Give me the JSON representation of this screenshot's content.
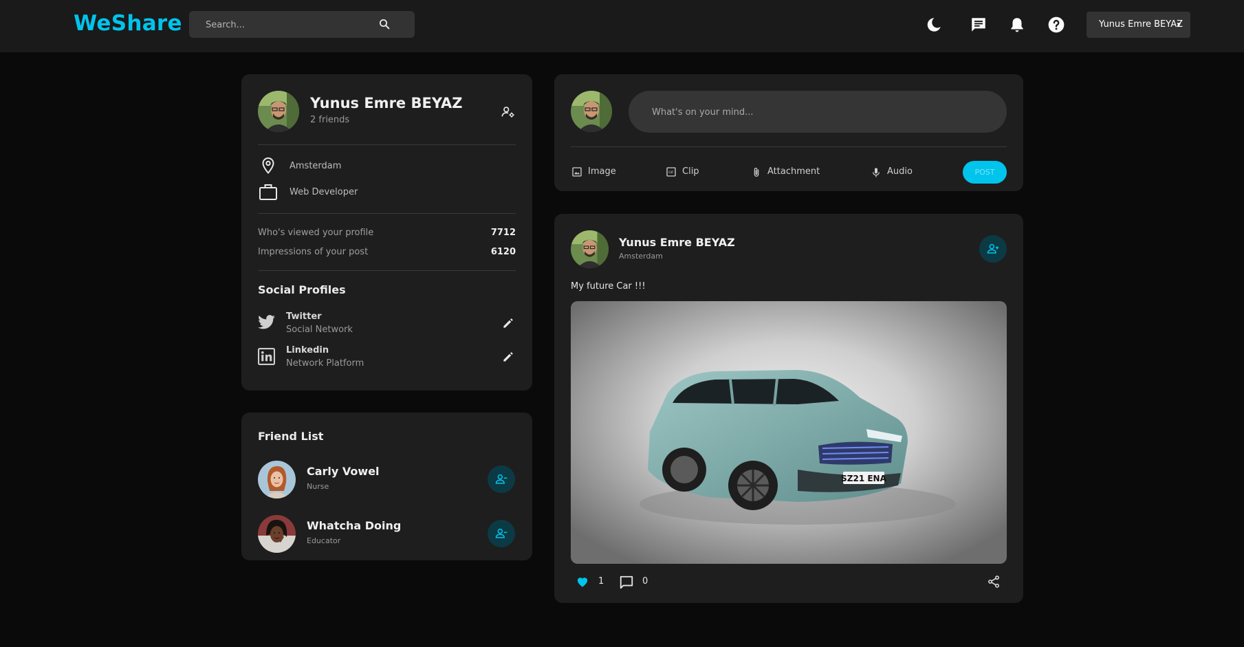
{
  "app": {
    "logo": "WeShare"
  },
  "header": {
    "search_placeholder": "Search...",
    "user_button_label": "Yunus Emre BEYAZ"
  },
  "profile": {
    "name": "Yunus Emre BEYAZ",
    "friends": "2 friends",
    "location": "Amsterdam",
    "occupation": "Web Developer",
    "stats": [
      {
        "label": "Who's viewed your profile",
        "value": "7712"
      },
      {
        "label": "Impressions of your post",
        "value": "6120"
      }
    ],
    "social_title": "Social Profiles",
    "social": [
      {
        "name": "Twitter",
        "desc": "Social Network"
      },
      {
        "name": "Linkedin",
        "desc": "Network Platform"
      }
    ]
  },
  "friend_list": {
    "title": "Friend List",
    "friends": [
      {
        "name": "Carly Vowel",
        "role": "Nurse"
      },
      {
        "name": "Whatcha Doing",
        "role": "Educator"
      }
    ]
  },
  "composer": {
    "placeholder": "What's on your mind...",
    "actions": [
      "Image",
      "Clip",
      "Attachment",
      "Audio"
    ],
    "post_label": "POST"
  },
  "post": {
    "author": "Yunus Emre BEYAZ",
    "location": "Amsterdam",
    "text": "My future Car !!!",
    "likes": "1",
    "comments": "0",
    "plate": "SZ21 ENA"
  },
  "colors": {
    "accent": "#00c4ec",
    "background": "#0a0a0a",
    "card": "#1e1e1e",
    "topbar": "#1a1a1a"
  }
}
